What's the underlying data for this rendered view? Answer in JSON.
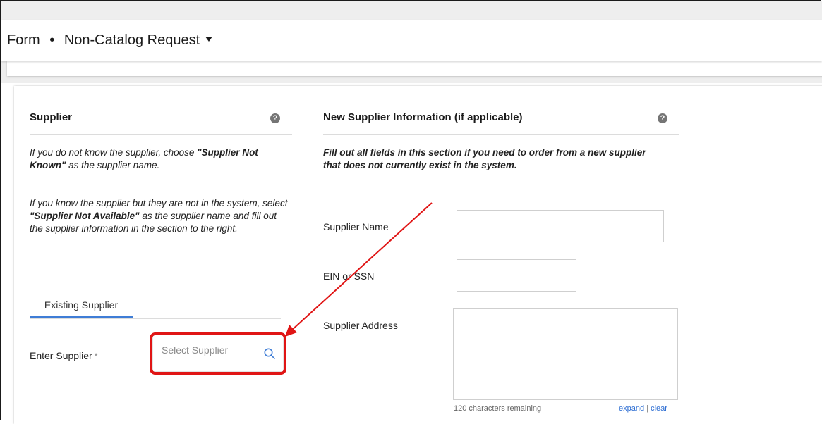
{
  "header": {
    "prefix": "Form",
    "separator": "•",
    "title": "Non-Catalog Request"
  },
  "supplier_section": {
    "title": "Supplier",
    "help": "?",
    "para1_pre": "If you do not know the supplier, choose ",
    "para1_strong": "\"Supplier Not Known\"",
    "para1_post": " as the supplier name.",
    "para2_pre": "If you know the supplier but they are not in the system, select ",
    "para2_strong": "\"Supplier Not Available\"",
    "para2_post": " as the supplier name and fill out the supplier information in the section to the right.",
    "tab_label": "Existing Supplier",
    "enter_label": "Enter Supplier",
    "required_mark": "*",
    "search_placeholder": "Select Supplier"
  },
  "new_supplier_section": {
    "title": "New Supplier Information (if applicable)",
    "help": "?",
    "instructions": "Fill out all fields in this section if you need to order from a new supplier that does not currently exist in the system.",
    "name_label": "Supplier Name",
    "name_value": "",
    "ein_label": "EIN or SSN",
    "ein_value": "",
    "address_label": "Supplier Address",
    "address_value": "",
    "chars_remaining": "120 characters remaining",
    "expand_label": "expand",
    "link_separator": "|",
    "clear_label": "clear"
  },
  "colors": {
    "accent_blue": "#3f7dd6",
    "annotation_red": "#e01515"
  }
}
